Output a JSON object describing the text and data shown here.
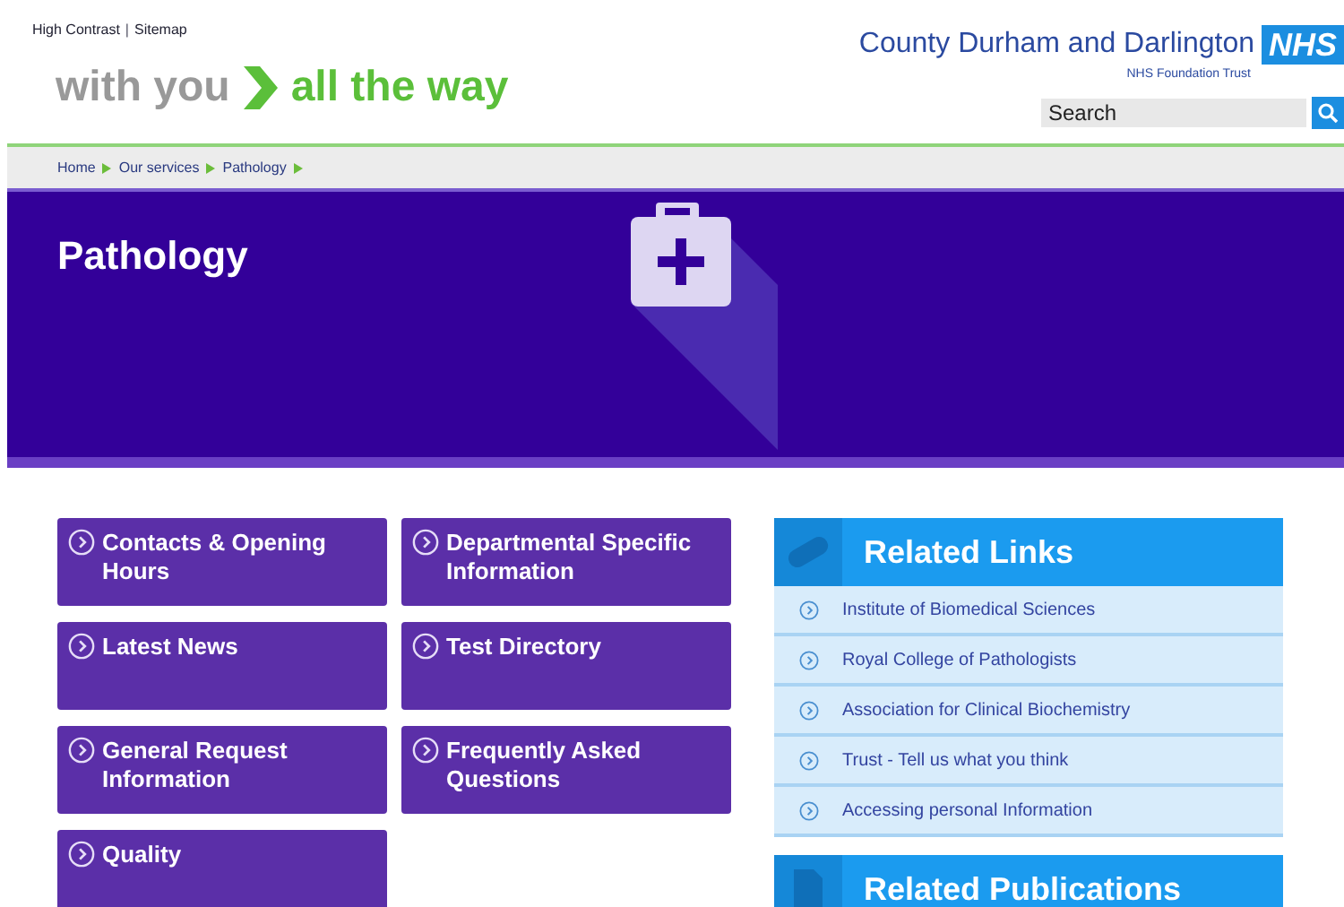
{
  "top_links": [
    "High Contrast",
    "Sitemap"
  ],
  "top_links_separator": "|",
  "slogan": {
    "left": "with you",
    "right": "all the way"
  },
  "org": {
    "name": "County Durham and Darlington",
    "badge": "NHS",
    "subtitle": "NHS Foundation Trust"
  },
  "search": {
    "placeholder": "Search"
  },
  "breadcrumb": [
    "Home",
    "Our services",
    "Pathology"
  ],
  "banner": {
    "title": "Pathology"
  },
  "tiles": [
    {
      "label": "Contacts & Opening Hours"
    },
    {
      "label": "Departmental Specific Information"
    },
    {
      "label": "Latest News"
    },
    {
      "label": "Test Directory"
    },
    {
      "label": "General Request Information"
    },
    {
      "label": "Frequently Asked Questions"
    },
    {
      "label": "Quality"
    }
  ],
  "related_links": {
    "title": "Related Links",
    "items": [
      "Institute of Biomedical Sciences",
      "Royal College of Pathologists",
      "Association for Clinical Biochemistry",
      "Trust - Tell us what you think",
      "Accessing personal Information"
    ]
  },
  "related_publications": {
    "title": "Related Publications"
  }
}
